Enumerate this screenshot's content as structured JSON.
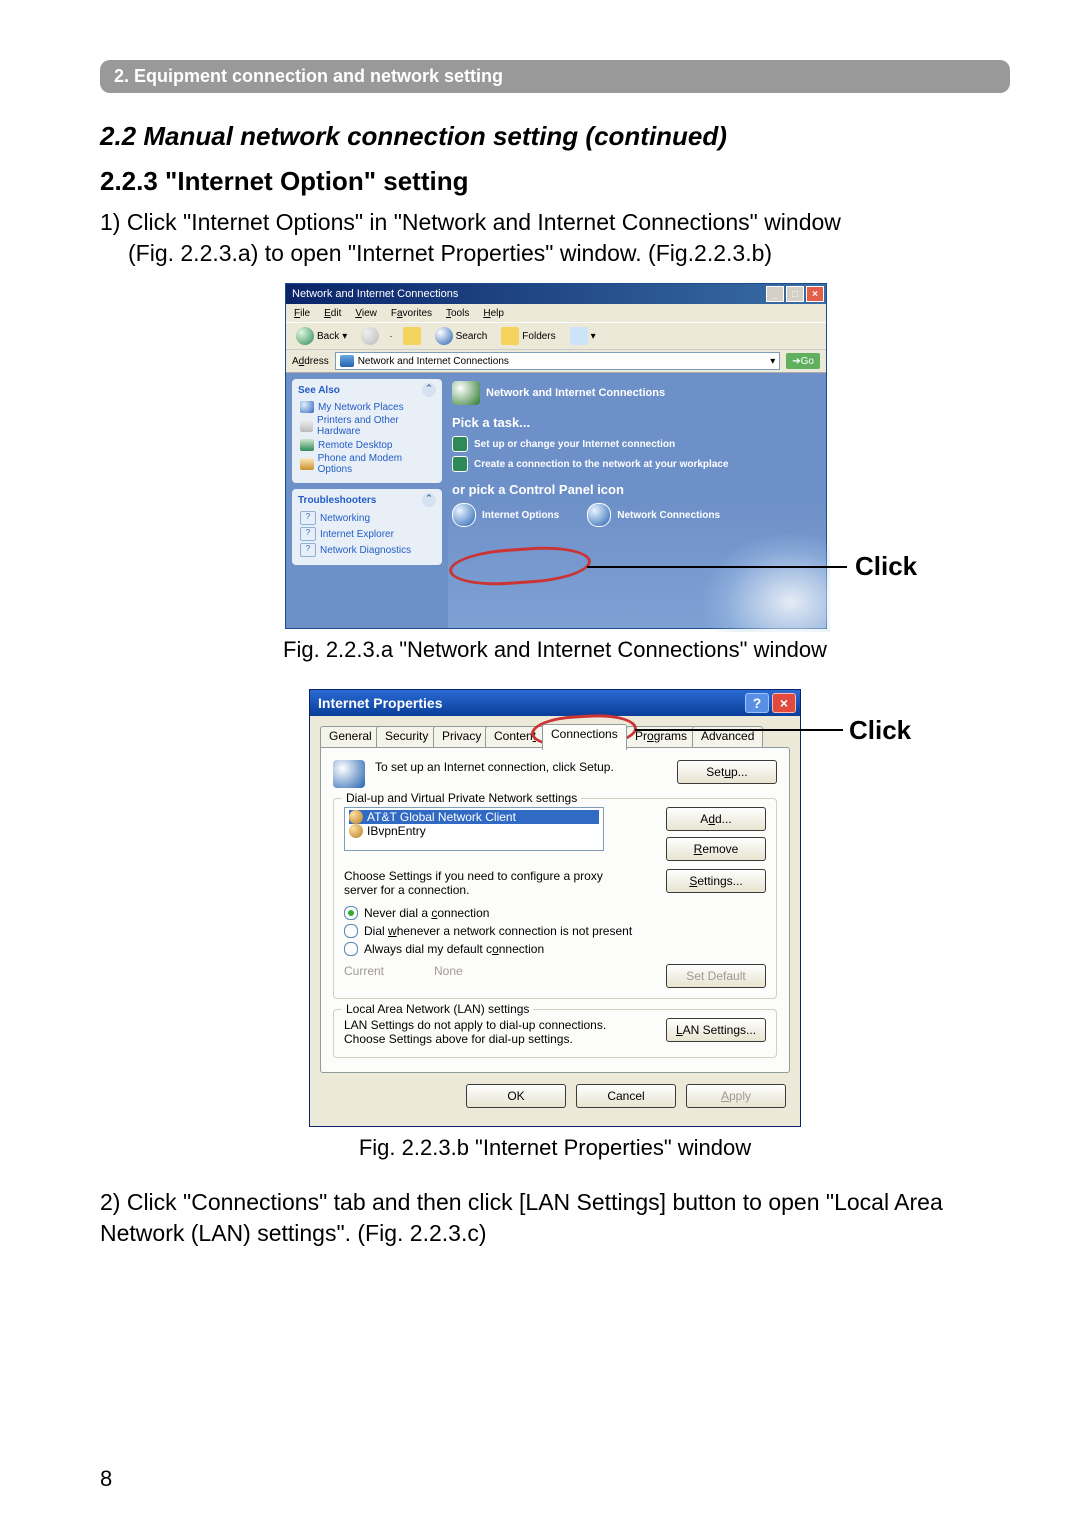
{
  "banner": "2. Equipment connection and network setting",
  "section_title": "2.2 Manual network connection setting (continued)",
  "subsection_title": "2.2.3 \"Internet Option\" setting",
  "step1_a": "1) Click \"Internet Options\" in \"Network and Internet Connections\" window",
  "step1_b": "(Fig. 2.2.3.a) to open \"Internet Properties\" window. (Fig.2.2.3.b)",
  "captionA": "Fig. 2.2.3.a \"Network and Internet Connections\" window",
  "captionB": "Fig. 2.2.3.b \"Internet Properties\" window",
  "step2": "2) Click \"Connections\" tab and then click [LAN Settings] button to open \"Local Area Network (LAN) settings\". (Fig. 2.2.3.c)",
  "click_label": "Click",
  "page_number": "8",
  "figA": {
    "title": "Network and Internet Connections",
    "menus": [
      "File",
      "Edit",
      "View",
      "Favorites",
      "Tools",
      "Help"
    ],
    "toolbar": {
      "back": "Back",
      "search": "Search",
      "folders": "Folders"
    },
    "address_label": "Address",
    "address_value": "Network and Internet Connections",
    "go": "Go",
    "see_also_head": "See Also",
    "see_also_items": [
      "My Network Places",
      "Printers and Other Hardware",
      "Remote Desktop",
      "Phone and Modem Options"
    ],
    "trouble_head": "Troubleshooters",
    "trouble_items": [
      "Networking",
      "Internet Explorer",
      "Network Diagnostics"
    ],
    "content_head": "Network and Internet Connections",
    "pick_task": "Pick a task...",
    "tasks": [
      "Set up or change your Internet connection",
      "Create a connection to the network at your workplace"
    ],
    "or_pick": "or pick a Control Panel icon",
    "cp_items": [
      "Internet Options",
      "Network Connections"
    ]
  },
  "figB": {
    "title": "Internet Properties",
    "tabs": [
      "General",
      "Security",
      "Privacy",
      "Content",
      "Connections",
      "Programs",
      "Advanced"
    ],
    "intro": "To set up an Internet connection, click Setup.",
    "setup_btn": "Setup...",
    "fieldset1": "Dial-up and Virtual Private Network settings",
    "list_items": [
      "AT&T Global Network Client",
      "IBvpnEntry"
    ],
    "add_btn": "Add...",
    "remove_btn": "Remove",
    "proxy_help": "Choose Settings if you need to configure a proxy server for a connection.",
    "settings_btn": "Settings...",
    "radios": [
      "Never dial a connection",
      "Dial whenever a network connection is not present",
      "Always dial my default connection"
    ],
    "current_label": "Current",
    "current_value": "None",
    "set_default_btn": "Set Default",
    "fieldset2": "Local Area Network (LAN) settings",
    "lan_help": "LAN Settings do not apply to dial-up connections. Choose Settings above for dial-up settings.",
    "lan_btn": "LAN Settings...",
    "ok_btn": "OK",
    "cancel_btn": "Cancel",
    "apply_btn": "Apply"
  }
}
